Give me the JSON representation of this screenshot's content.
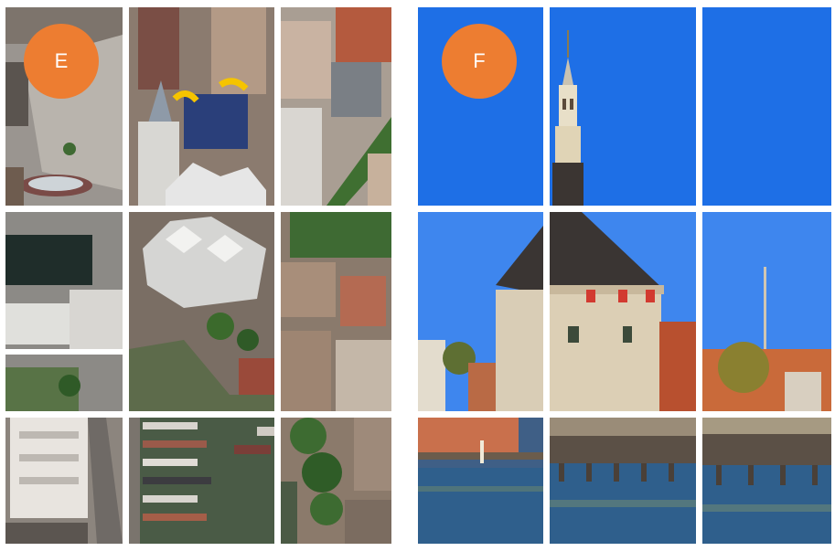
{
  "theme": {
    "badge_color": "#ED7D31",
    "sky": "#1E6FE6",
    "water": "#3F5F86"
  },
  "puzzle_e": {
    "label": "E",
    "description_icon": "aerial-city-photo",
    "tiles": [
      {
        "id": "e1",
        "scene": "plaza"
      },
      {
        "id": "e2",
        "scene": "towers-yellow-roof"
      },
      {
        "id": "e3",
        "scene": "towers-green-strip"
      },
      {
        "id": "e4",
        "scene": "office-buildings"
      },
      {
        "id": "e5",
        "scene": "cube-houses-harbor"
      },
      {
        "id": "e6",
        "scene": "rooftops-trees"
      },
      {
        "id": "e7",
        "scene": "white-building-street"
      },
      {
        "id": "e8",
        "scene": "boats-harbor"
      },
      {
        "id": "e9",
        "scene": "trees-canal"
      }
    ]
  },
  "puzzle_f": {
    "label": "F",
    "description_icon": "tower-harbor-photo",
    "tiles": [
      {
        "id": "f1",
        "scene": "sky"
      },
      {
        "id": "f2",
        "scene": "spire"
      },
      {
        "id": "f3",
        "scene": "sky"
      },
      {
        "id": "f4",
        "scene": "tower-roof-left"
      },
      {
        "id": "f5",
        "scene": "tower-body"
      },
      {
        "id": "f6",
        "scene": "houses-mast"
      },
      {
        "id": "f7",
        "scene": "quay-left"
      },
      {
        "id": "f8",
        "scene": "pier-center"
      },
      {
        "id": "f9",
        "scene": "pier-right"
      }
    ]
  }
}
